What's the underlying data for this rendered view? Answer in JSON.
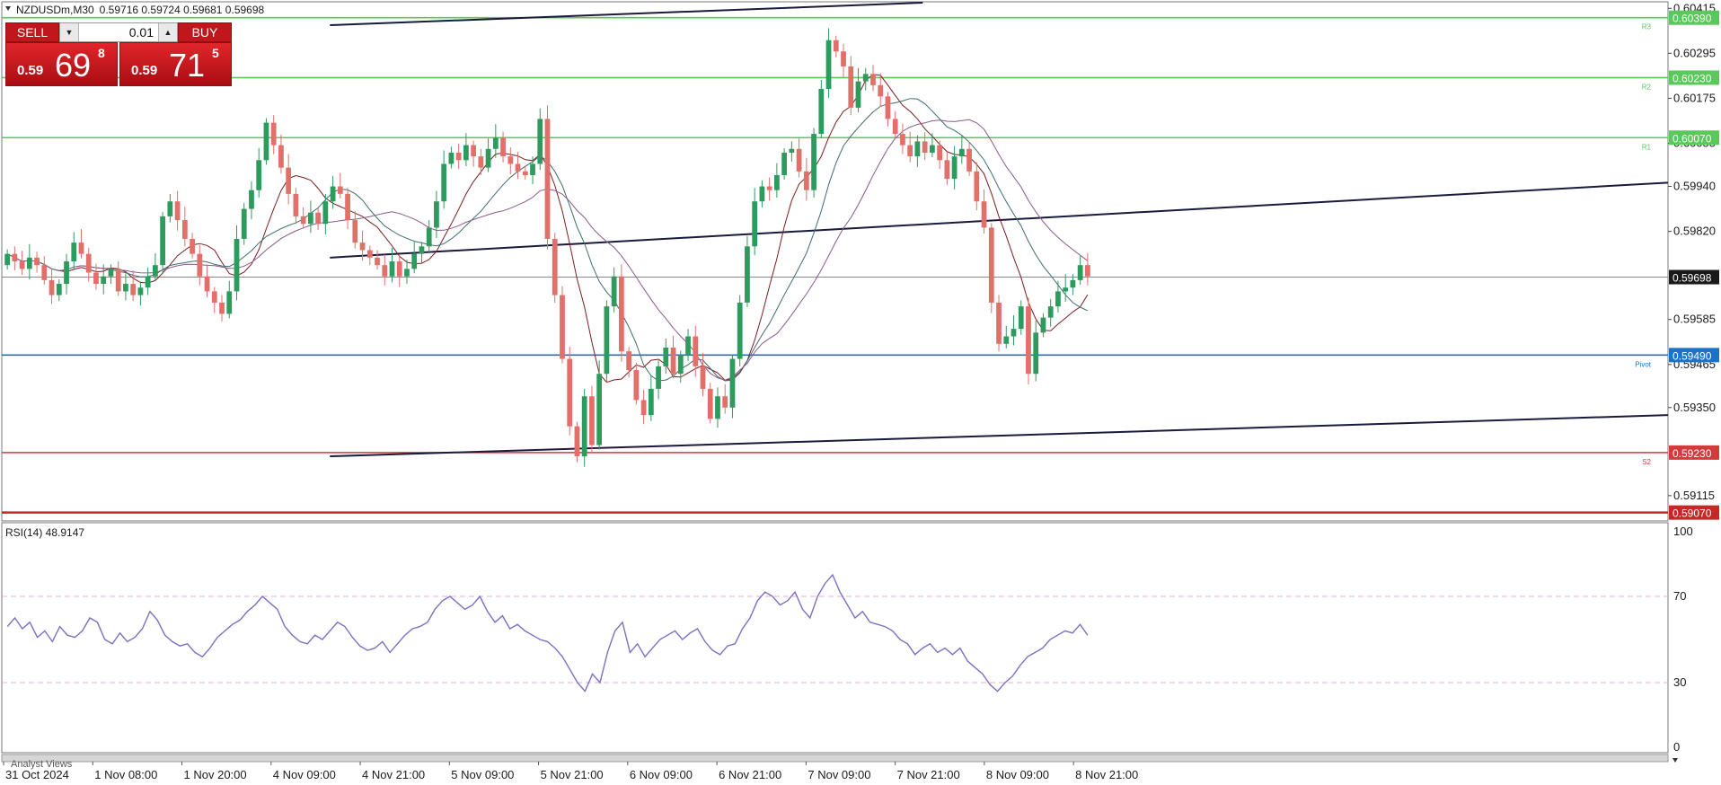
{
  "header": {
    "symbol": "NZDUSDm,M30",
    "ohlc": "0.59716 0.59724 0.59681 0.59698"
  },
  "trade_panel": {
    "sell_label": "SELL",
    "buy_label": "BUY",
    "lot": "0.01",
    "sell_price": {
      "big_prefix": "0.59",
      "big": "69",
      "sup": "8"
    },
    "buy_price": {
      "big_prefix": "0.59",
      "big": "71",
      "sup": "5"
    },
    "colors": {
      "button": "#c0171c"
    }
  },
  "rsi": {
    "label": "RSI(14) 48.9147",
    "levels": [
      "100",
      "70",
      "30",
      "0"
    ]
  },
  "footer": {
    "analyst_views": "Analyst Views"
  },
  "chart_data": [
    {
      "type": "candlestick",
      "symbol": "NZDUSDm",
      "timeframe": "M30",
      "y_ticks": [
        0.60415,
        0.60295,
        0.60175,
        0.60055,
        0.5994,
        0.5982,
        0.59585,
        0.59465,
        0.5935,
        0.59115
      ],
      "ylim": [
        0.5905,
        0.6043
      ],
      "x_ticks": [
        "31 Oct 2024",
        "1 Nov 08:00",
        "1 Nov 20:00",
        "4 Nov 09:00",
        "4 Nov 21:00",
        "5 Nov 09:00",
        "5 Nov 21:00",
        "6 Nov 09:00",
        "6 Nov 21:00",
        "7 Nov 09:00",
        "7 Nov 21:00",
        "8 Nov 09:00",
        "8 Nov 21:00"
      ],
      "current_price": "0.59698",
      "levels": [
        {
          "name": "R3",
          "value": "0.60390",
          "color": "#5bc85b"
        },
        {
          "name": "R2",
          "value": "0.60230",
          "color": "#5bc85b"
        },
        {
          "name": "R1",
          "value": "0.60070",
          "color": "#5bc85b"
        },
        {
          "name": "Pivot",
          "value": "0.59490",
          "color": "#1a73c9"
        },
        {
          "name": "S2",
          "value": "0.59230",
          "color": "#d23b3b"
        },
        {
          "name": "",
          "value": "0.59070",
          "color": "#c62828"
        }
      ],
      "closes": [
        0.5976,
        0.5974,
        0.5972,
        0.5975,
        0.5973,
        0.5969,
        0.5965,
        0.5968,
        0.5974,
        0.5979,
        0.5976,
        0.5971,
        0.5968,
        0.597,
        0.5972,
        0.5966,
        0.5968,
        0.5965,
        0.5967,
        0.597,
        0.5973,
        0.5986,
        0.599,
        0.5985,
        0.598,
        0.5976,
        0.597,
        0.5966,
        0.5963,
        0.596,
        0.5966,
        0.598,
        0.5988,
        0.5993,
        0.6001,
        0.6011,
        0.6005,
        0.5999,
        0.5992,
        0.5986,
        0.5984,
        0.5987,
        0.5984,
        0.599,
        0.5994,
        0.5992,
        0.5985,
        0.5979,
        0.5977,
        0.5975,
        0.5973,
        0.597,
        0.5974,
        0.597,
        0.5972,
        0.5976,
        0.5978,
        0.5983,
        0.599,
        0.6,
        0.6003,
        0.6001,
        0.6005,
        0.6002,
        0.5999,
        0.6004,
        0.6007,
        0.6002,
        0.6,
        0.5998,
        0.5997,
        0.6,
        0.6012,
        0.598,
        0.5965,
        0.5948,
        0.593,
        0.5922,
        0.5938,
        0.5925,
        0.5944,
        0.5962,
        0.597,
        0.595,
        0.5945,
        0.5937,
        0.5933,
        0.594,
        0.5946,
        0.5951,
        0.5944,
        0.5949,
        0.5954,
        0.5946,
        0.594,
        0.5932,
        0.5938,
        0.5935,
        0.5948,
        0.5963,
        0.5978,
        0.599,
        0.5994,
        0.5993,
        0.5997,
        0.6003,
        0.6004,
        0.5998,
        0.5993,
        0.6008,
        0.602,
        0.6033,
        0.603,
        0.6026,
        0.6015,
        0.6022,
        0.6024,
        0.6021,
        0.6018,
        0.6012,
        0.6008,
        0.6005,
        0.6002,
        0.6006,
        0.6003,
        0.6005,
        0.6001,
        0.5996,
        0.6002,
        0.6004,
        0.5998,
        0.599,
        0.5983,
        0.5963,
        0.5952,
        0.5954,
        0.5956,
        0.5962,
        0.5944,
        0.5955,
        0.5959,
        0.5962,
        0.5966,
        0.5967,
        0.5969,
        0.5973,
        0.597
      ],
      "ma_fast_color": "#7a1f1f",
      "ma_mid_color": "#3f6e6e",
      "ma_slow_color": "#8a5a8a",
      "channel_color": "#1a1a3d"
    },
    {
      "type": "line",
      "name": "RSI(14)",
      "ylim": [
        0,
        100
      ],
      "levels": [
        70,
        30
      ],
      "color": "#7e6fc1",
      "values": [
        56,
        60,
        55,
        58,
        51,
        54,
        49,
        56,
        52,
        51,
        54,
        60,
        58,
        50,
        48,
        53,
        49,
        51,
        55,
        63,
        59,
        52,
        49,
        47,
        48,
        44,
        42,
        46,
        51,
        54,
        57,
        59,
        63,
        66,
        70,
        67,
        64,
        56,
        52,
        49,
        48,
        52,
        50,
        54,
        58,
        56,
        51,
        47,
        45,
        46,
        49,
        44,
        48,
        52,
        55,
        56,
        58,
        64,
        68,
        70,
        67,
        64,
        66,
        70,
        63,
        58,
        61,
        55,
        57,
        54,
        52,
        50,
        49,
        46,
        42,
        36,
        30,
        26,
        34,
        30,
        44,
        54,
        58,
        44,
        48,
        42,
        46,
        50,
        52,
        54,
        50,
        53,
        55,
        49,
        45,
        43,
        47,
        48,
        55,
        60,
        68,
        72,
        70,
        66,
        68,
        72,
        64,
        60,
        70,
        76,
        80,
        72,
        66,
        60,
        63,
        58,
        57,
        56,
        54,
        50,
        48,
        43,
        46,
        48,
        44,
        46,
        43,
        46,
        40,
        37,
        34,
        29,
        26,
        30,
        33,
        38,
        42,
        44,
        46,
        50,
        52,
        54,
        53,
        57,
        52
      ]
    }
  ]
}
